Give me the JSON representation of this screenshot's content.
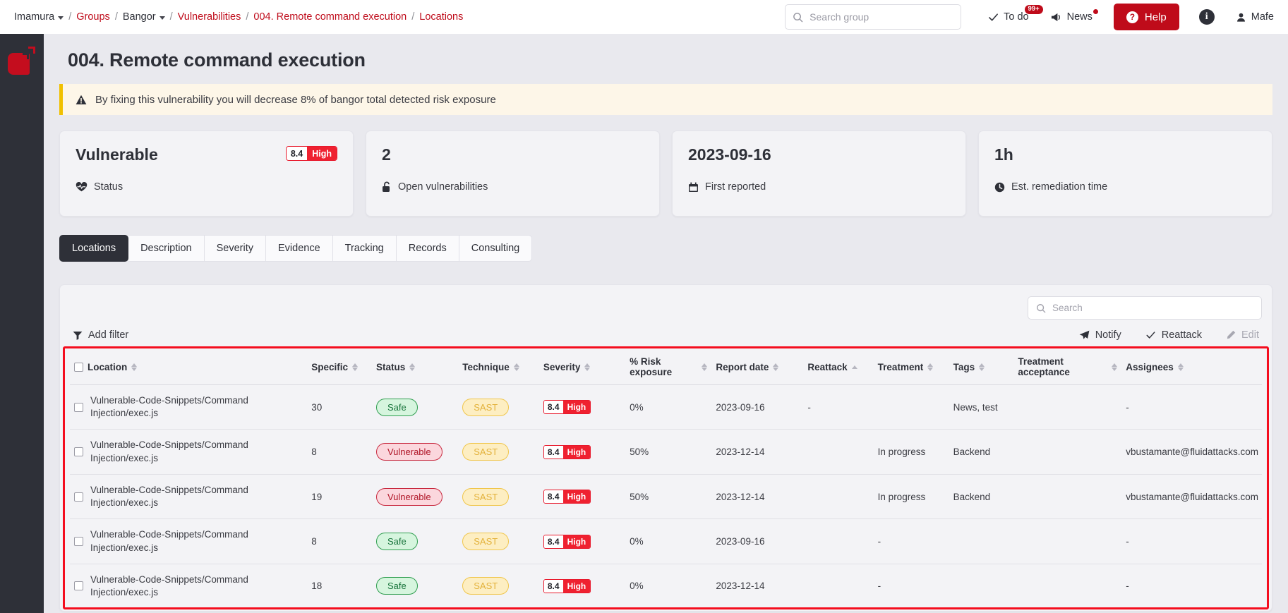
{
  "breadcrumb": {
    "org": "Imamura",
    "groups": "Groups",
    "group": "Bangor",
    "vulnerabilities": "Vulnerabilities",
    "finding": "004. Remote command execution",
    "section": "Locations",
    "sep": "/"
  },
  "header": {
    "search_placeholder": "Search group",
    "todo_label": "To do",
    "todo_badge": "99+",
    "news_label": "News",
    "help_label": "Help",
    "user_name": "Mafe"
  },
  "page": {
    "title": "004. Remote command execution",
    "alert": "By fixing this vulnerability you will decrease 8% of bangor total detected risk exposure"
  },
  "cards": [
    {
      "value": "Vulnerable",
      "label": "Status",
      "icon": "heartbeat-icon",
      "severity_score": "8.4",
      "severity_level": "High"
    },
    {
      "value": "2",
      "label": "Open vulnerabilities",
      "icon": "unlock-icon"
    },
    {
      "value": "2023-09-16",
      "label": "First reported",
      "icon": "calendar-icon"
    },
    {
      "value": "1h",
      "label": "Est. remediation time",
      "icon": "clock-icon"
    }
  ],
  "tabs": [
    {
      "label": "Locations",
      "active": true
    },
    {
      "label": "Description",
      "active": false
    },
    {
      "label": "Severity",
      "active": false
    },
    {
      "label": "Evidence",
      "active": false
    },
    {
      "label": "Tracking",
      "active": false
    },
    {
      "label": "Records",
      "active": false
    },
    {
      "label": "Consulting",
      "active": false
    }
  ],
  "toolbar": {
    "search_placeholder": "Search",
    "add_filter": "Add filter",
    "notify": "Notify",
    "reattack": "Reattack",
    "edit": "Edit"
  },
  "table": {
    "columns": [
      {
        "label": "Location",
        "sort": "both",
        "width": "22%"
      },
      {
        "label": "Specific",
        "sort": "both",
        "width": "6%"
      },
      {
        "label": "Status",
        "sort": "both",
        "width": "8%"
      },
      {
        "label": "Technique",
        "sort": "both",
        "width": "7.5%"
      },
      {
        "label": "Severity",
        "sort": "both",
        "width": "8%"
      },
      {
        "label": "% Risk exposure",
        "sort": "both",
        "width": "8%"
      },
      {
        "label": "Report date",
        "sort": "both",
        "width": "8.5%"
      },
      {
        "label": "Reattack",
        "sort": "up",
        "width": "6.5%"
      },
      {
        "label": "Treatment",
        "sort": "both",
        "width": "7%"
      },
      {
        "label": "Tags",
        "sort": "both",
        "width": "6%"
      },
      {
        "label": "Treatment acceptance",
        "sort": "both",
        "width": "10%"
      },
      {
        "label": "Assignees",
        "sort": "both",
        "width": "13%"
      }
    ],
    "rows": [
      {
        "location": "Vulnerable-Code-Snippets/Command Injection/exec.js",
        "specific": "30",
        "status": "Safe",
        "status_kind": "safe",
        "technique": "SAST",
        "severity_score": "8.4",
        "severity_level": "High",
        "risk": "0%",
        "report_date": "2023-09-16",
        "reattack": "-",
        "treatment": "",
        "tags": "News, test",
        "acceptance": "",
        "assignees": "-"
      },
      {
        "location": "Vulnerable-Code-Snippets/Command Injection/exec.js",
        "specific": "8",
        "status": "Vulnerable",
        "status_kind": "vuln",
        "technique": "SAST",
        "severity_score": "8.4",
        "severity_level": "High",
        "risk": "50%",
        "report_date": "2023-12-14",
        "reattack": "",
        "treatment": "In progress",
        "tags": "Backend",
        "acceptance": "",
        "assignees": "vbustamante@fluidattacks.com"
      },
      {
        "location": "Vulnerable-Code-Snippets/Command Injection/exec.js",
        "specific": "19",
        "status": "Vulnerable",
        "status_kind": "vuln",
        "technique": "SAST",
        "severity_score": "8.4",
        "severity_level": "High",
        "risk": "50%",
        "report_date": "2023-12-14",
        "reattack": "",
        "treatment": "In progress",
        "tags": "Backend",
        "acceptance": "",
        "assignees": "vbustamante@fluidattacks.com"
      },
      {
        "location": "Vulnerable-Code-Snippets/Command Injection/exec.js",
        "specific": "8",
        "status": "Safe",
        "status_kind": "safe",
        "technique": "SAST",
        "severity_score": "8.4",
        "severity_level": "High",
        "risk": "0%",
        "report_date": "2023-09-16",
        "reattack": "",
        "treatment": "-",
        "tags": "",
        "acceptance": "",
        "assignees": "-"
      },
      {
        "location": "Vulnerable-Code-Snippets/Command Injection/exec.js",
        "specific": "18",
        "status": "Safe",
        "status_kind": "safe",
        "technique": "SAST",
        "severity_score": "8.4",
        "severity_level": "High",
        "risk": "0%",
        "report_date": "2023-12-14",
        "reattack": "",
        "treatment": "-",
        "tags": "",
        "acceptance": "",
        "assignees": "-"
      }
    ]
  },
  "colors": {
    "brand_red": "#bf0b1a",
    "sidebar_dark": "#2e3038",
    "highlight_red": "#f40d1e",
    "alert_bg": "#fdf6e8",
    "alert_border": "#f0c000"
  }
}
